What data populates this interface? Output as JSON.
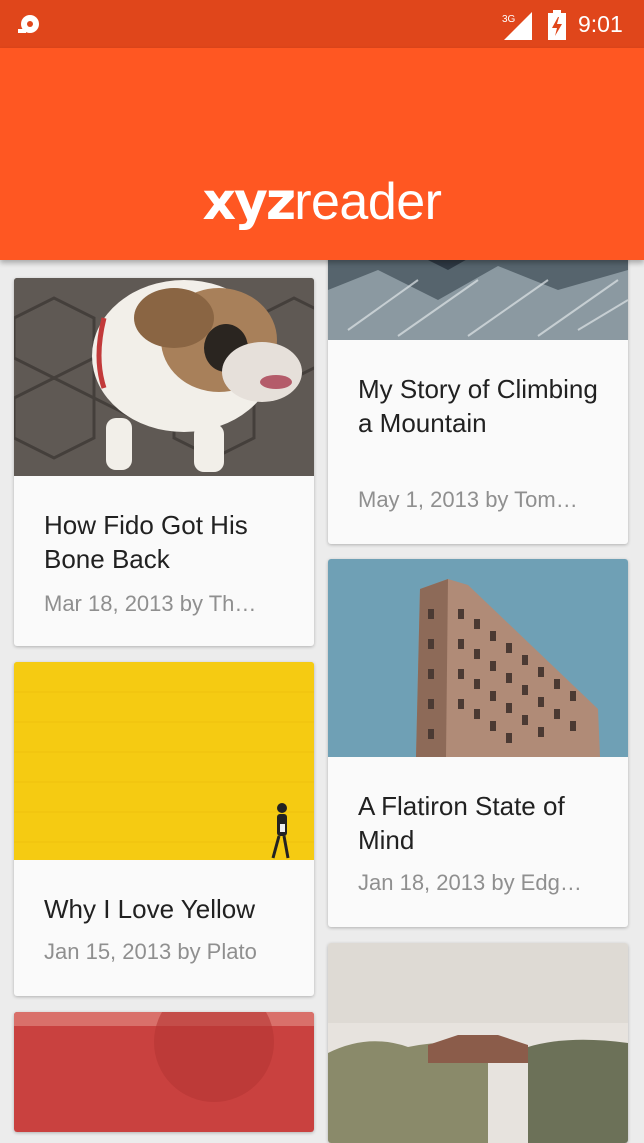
{
  "status_bar": {
    "network": "3G",
    "time": "9:01"
  },
  "app_bar": {
    "logo_bold": "xyz",
    "logo_light": "reader"
  },
  "articles": [
    {
      "title": "How Fido Got His Bone Back",
      "meta": "Mar 18, 2013 by Th…"
    },
    {
      "title": "Why I Love Yellow",
      "meta": "Jan 15, 2013 by Plato"
    },
    {
      "title": "My Story of Climbing a Mountain",
      "meta": "May 1, 2013 by Tom…"
    },
    {
      "title": "A Flatiron State of Mind",
      "meta": "Jan 18, 2013 by Edg…"
    }
  ],
  "colors": {
    "status_bar": "#e0461b",
    "app_bar": "#ff5722",
    "background": "#ececec",
    "card": "#fafafa"
  }
}
